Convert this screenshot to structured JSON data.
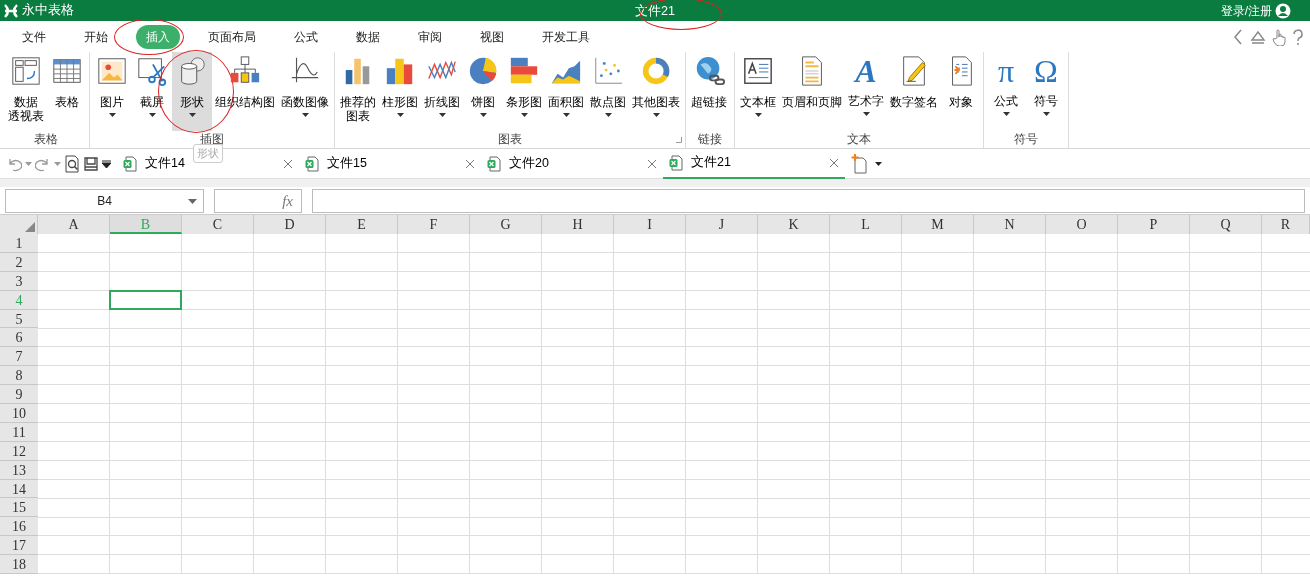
{
  "app": {
    "name": "永中表格"
  },
  "title": {
    "text": "文件21",
    "circled": true
  },
  "account": {
    "label": "登录/注册"
  },
  "menu_tabs": [
    {
      "label": "文件",
      "selected": false,
      "circled": false
    },
    {
      "label": "开始",
      "selected": false,
      "circled": false
    },
    {
      "label": "插入",
      "selected": true,
      "circled": true
    },
    {
      "label": "页面布局",
      "selected": false,
      "circled": false
    },
    {
      "label": "公式",
      "selected": false,
      "circled": false
    },
    {
      "label": "数据",
      "selected": false,
      "circled": false
    },
    {
      "label": "审阅",
      "selected": false,
      "circled": false
    },
    {
      "label": "视图",
      "selected": false,
      "circled": false
    },
    {
      "label": "开发工具",
      "selected": false,
      "circled": false
    }
  ],
  "ribbon_groups": [
    {
      "label": "表格",
      "items": [
        {
          "kind": "drawing",
          "label": [
            "数据",
            "透视表"
          ],
          "dropdown": false,
          "highlighted": false,
          "circled": false
        },
        {
          "kind": "drawing",
          "label": "表格",
          "dropdown": false,
          "highlighted": false,
          "circled": false
        }
      ]
    },
    {
      "label": "插图",
      "items": [
        {
          "kind": "drawing",
          "label": "图片",
          "dropdown": true,
          "highlighted": false,
          "circled": false
        },
        {
          "kind": "drawing",
          "label": "截屏",
          "dropdown": true,
          "highlighted": false,
          "circled": false
        },
        {
          "kind": "drawing",
          "label": "形状",
          "dropdown": true,
          "highlighted": true,
          "circled": true
        },
        {
          "kind": "drawing",
          "label": "组织结构图",
          "dropdown": false,
          "highlighted": false,
          "circled": false
        },
        {
          "kind": "drawing",
          "label": "函数图像",
          "dropdown": true,
          "highlighted": false,
          "circled": false
        }
      ]
    },
    {
      "label": "图表",
      "launcher": true,
      "items": [
        {
          "kind": "drawing",
          "label": [
            "推荐的",
            "图表"
          ],
          "dropdown": false,
          "highlighted": false,
          "circled": false
        },
        {
          "kind": "drawing",
          "label": "柱形图",
          "dropdown": true,
          "highlighted": false,
          "circled": false
        },
        {
          "kind": "drawing",
          "label": "折线图",
          "dropdown": true,
          "highlighted": false,
          "circled": false
        },
        {
          "kind": "drawing",
          "label": "饼图",
          "dropdown": true,
          "highlighted": false,
          "circled": false
        },
        {
          "kind": "drawing",
          "label": "条形图",
          "dropdown": true,
          "highlighted": false,
          "circled": false
        },
        {
          "kind": "drawing",
          "label": "面积图",
          "dropdown": true,
          "highlighted": false,
          "circled": false
        },
        {
          "kind": "drawing",
          "label": "散点图",
          "dropdown": true,
          "highlighted": false,
          "circled": false
        },
        {
          "kind": "drawing",
          "label": "其他图表",
          "dropdown": true,
          "highlighted": false,
          "circled": false
        }
      ]
    },
    {
      "label": "链接",
      "items": [
        {
          "kind": "drawing",
          "label": "超链接",
          "dropdown": false,
          "highlighted": false,
          "circled": false
        }
      ]
    },
    {
      "label": "文本",
      "items": [
        {
          "kind": "drawing",
          "label": "文本框",
          "dropdown": true,
          "highlighted": false,
          "circled": false
        },
        {
          "kind": "drawing",
          "label": "页眉和页脚",
          "dropdown": false,
          "highlighted": false,
          "circled": false
        },
        {
          "kind": "glyph",
          "glyph": "A",
          "label": "艺术字",
          "dropdown": true,
          "highlighted": false,
          "circled": false
        },
        {
          "kind": "drawing",
          "label": "数字签名",
          "dropdown": false,
          "highlighted": false,
          "circled": false
        },
        {
          "kind": "drawing",
          "label": "对象",
          "dropdown": false,
          "highlighted": false,
          "circled": false
        }
      ]
    },
    {
      "label": "符号",
      "items": [
        {
          "kind": "glyph",
          "glyph": "π",
          "label": "公式",
          "dropdown": true,
          "highlighted": false,
          "circled": false
        },
        {
          "kind": "glyph",
          "glyph": "Ω",
          "label": "符号",
          "dropdown": true,
          "highlighted": false,
          "circled": false
        }
      ]
    }
  ],
  "tooltip": {
    "text": "形状"
  },
  "doc_tabs": [
    {
      "label": "文件14",
      "selected": false
    },
    {
      "label": "文件15",
      "selected": false
    },
    {
      "label": "文件20",
      "selected": false
    },
    {
      "label": "文件21",
      "selected": true
    }
  ],
  "name_box": {
    "value": "B4"
  },
  "formula_bar": {
    "fx": "fx"
  },
  "columns": [
    {
      "label": "A",
      "selected": false
    },
    {
      "label": "B",
      "selected": true
    },
    {
      "label": "C",
      "selected": false
    },
    {
      "label": "D",
      "selected": false
    },
    {
      "label": "E",
      "selected": false
    },
    {
      "label": "F",
      "selected": false
    },
    {
      "label": "G",
      "selected": false
    },
    {
      "label": "H",
      "selected": false
    },
    {
      "label": "I",
      "selected": false
    },
    {
      "label": "J",
      "selected": false
    },
    {
      "label": "K",
      "selected": false
    },
    {
      "label": "L",
      "selected": false
    },
    {
      "label": "M",
      "selected": false
    },
    {
      "label": "N",
      "selected": false
    },
    {
      "label": "O",
      "selected": false
    },
    {
      "label": "P",
      "selected": false
    },
    {
      "label": "Q",
      "selected": false
    },
    {
      "label": "R",
      "selected": false
    }
  ],
  "rows": [
    {
      "label": "1",
      "selected": false
    },
    {
      "label": "2",
      "selected": false
    },
    {
      "label": "3",
      "selected": false
    },
    {
      "label": "4",
      "selected": true
    },
    {
      "label": "5",
      "selected": false
    },
    {
      "label": "6",
      "selected": false
    },
    {
      "label": "7",
      "selected": false
    },
    {
      "label": "8",
      "selected": false
    },
    {
      "label": "9",
      "selected": false
    },
    {
      "label": "10",
      "selected": false
    },
    {
      "label": "11",
      "selected": false
    },
    {
      "label": "12",
      "selected": false
    },
    {
      "label": "13",
      "selected": false
    },
    {
      "label": "14",
      "selected": false
    },
    {
      "label": "15",
      "selected": false
    },
    {
      "label": "16",
      "selected": false
    },
    {
      "label": "17",
      "selected": false
    },
    {
      "label": "18",
      "selected": false
    }
  ]
}
